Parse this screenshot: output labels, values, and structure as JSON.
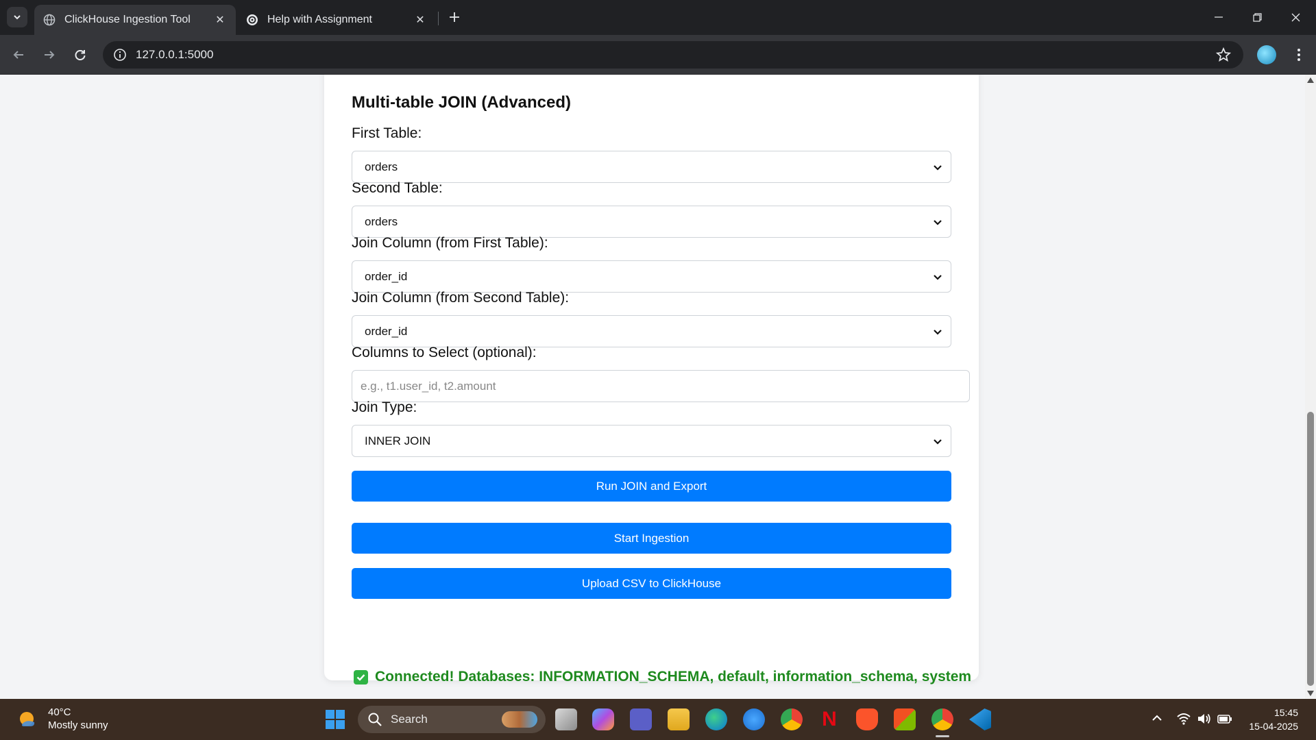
{
  "browser": {
    "tabs": [
      {
        "title": "ClickHouse Ingestion Tool",
        "active": true
      },
      {
        "title": "Help with Assignment",
        "active": false
      }
    ],
    "url": "127.0.0.1:5000"
  },
  "page": {
    "section_title": "Multi-table JOIN (Advanced)",
    "first_table": {
      "label": "First Table:",
      "value": "orders"
    },
    "second_table": {
      "label": "Second Table:",
      "value": "orders"
    },
    "join_col_first": {
      "label": "Join Column (from First Table):",
      "value": "order_id"
    },
    "join_col_second": {
      "label": "Join Column (from Second Table):",
      "value": "order_id"
    },
    "columns_select": {
      "label": "Columns to Select (optional):",
      "placeholder": "e.g., t1.user_id, t2.amount",
      "value": ""
    },
    "join_type": {
      "label": "Join Type:",
      "value": "INNER JOIN"
    },
    "buttons": {
      "run_join": "Run JOIN and Export",
      "start_ingestion": "Start Ingestion",
      "upload_csv": "Upload CSV to ClickHouse"
    },
    "status": "Connected! Databases: INFORMATION_SCHEMA, default, information_schema, system"
  },
  "taskbar": {
    "weather": {
      "temp": "40°C",
      "condition": "Mostly sunny"
    },
    "search_placeholder": "Search",
    "time": "15:45",
    "date": "15-04-2025",
    "apps": [
      "file-manager-icon",
      "copilot-icon",
      "teams-icon",
      "file-explorer-icon",
      "edge-icon",
      "help-icon",
      "chrome-icon",
      "netflix-icon",
      "brave-icon",
      "store-icon",
      "chrome-active-icon",
      "vscode-icon"
    ]
  },
  "colors": {
    "button_blue": "#007bff",
    "success_green": "#1e8a1e",
    "chrome_dark": "#202124",
    "taskbar": "#3b2c22"
  }
}
